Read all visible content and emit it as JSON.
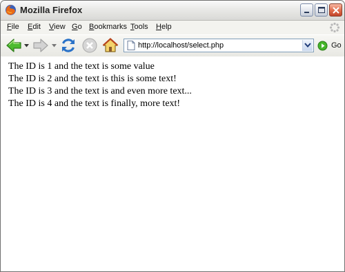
{
  "window": {
    "title": "Mozilla Firefox"
  },
  "menu": {
    "items": [
      {
        "key": "F",
        "rest": "ile"
      },
      {
        "key": "E",
        "rest": "dit"
      },
      {
        "key": "V",
        "rest": "iew"
      },
      {
        "key": "G",
        "rest": "o"
      },
      {
        "key": "B",
        "rest": "ookmarks"
      },
      {
        "key": "T",
        "rest": "ools"
      },
      {
        "key": "H",
        "rest": "elp"
      }
    ]
  },
  "toolbar": {
    "url": "http://localhost/select.php",
    "go_label": "Go"
  },
  "content": {
    "lines": [
      "The ID is 1 and the text is some value",
      "The ID is 2 and the text is this is some text!",
      "The ID is 3 and the text is and even more text...",
      "The ID is 4 and the text is finally, more text!"
    ]
  },
  "icons": {
    "app": "firefox-logo-icon",
    "back": "back-arrow-icon",
    "forward": "forward-arrow-icon",
    "reload": "reload-icon",
    "stop": "stop-icon",
    "home": "home-icon",
    "page": "page-icon",
    "go": "go-icon",
    "throbber": "throbber-icon"
  },
  "colors": {
    "back_arrow": "#3aa12a",
    "reload": "#2a72c8",
    "url_border": "#7f9db9"
  }
}
